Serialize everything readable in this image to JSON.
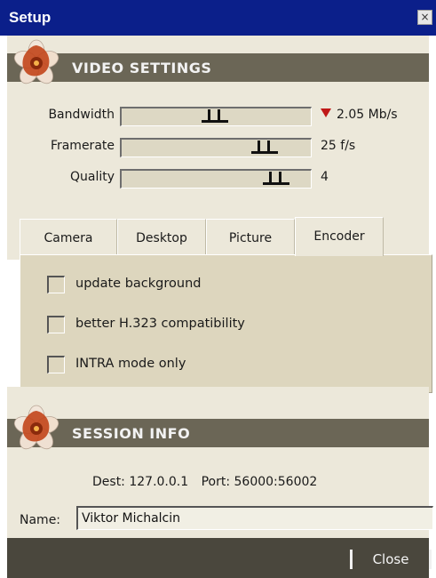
{
  "window": {
    "title": "Setup",
    "close_glyph": "×"
  },
  "sections": {
    "video_settings": "VIDEO SETTINGS",
    "session_info": "SESSION INFO"
  },
  "sliders": [
    {
      "label": "Bandwidth",
      "value_text": "2.05 Mb/s",
      "position": 0.49,
      "indicator": "red-down-arrow"
    },
    {
      "label": "Framerate",
      "value_text": "25 f/s",
      "position": 0.8
    },
    {
      "label": "Quality",
      "value_text": "4",
      "position": 0.87
    }
  ],
  "tabs": [
    {
      "label": "Camera",
      "active": false
    },
    {
      "label": "Desktop",
      "active": false
    },
    {
      "label": "Picture",
      "active": false
    },
    {
      "label": "Encoder",
      "active": true
    }
  ],
  "encoder_options": [
    {
      "label": "update background",
      "checked": false
    },
    {
      "label": "better H.323 compatibility",
      "checked": false
    },
    {
      "label": "INTRA mode only",
      "checked": false
    }
  ],
  "session": {
    "dest_text": "Dest: 127.0.0.1",
    "port_text": "Port: 56000:56002",
    "name_label": "Name:",
    "name_value": "Viktor Michalcin"
  },
  "footer": {
    "close_label": "Close"
  },
  "colors": {
    "title_bar": "#0b1f8a",
    "section_header": "#6b6656",
    "panel": "#ece8da",
    "bottom_bar": "#4a473d",
    "indicator_red": "#c01818"
  },
  "icons": [
    "flower-logo-icon",
    "red-down-arrow-icon",
    "window-close-icon"
  ]
}
